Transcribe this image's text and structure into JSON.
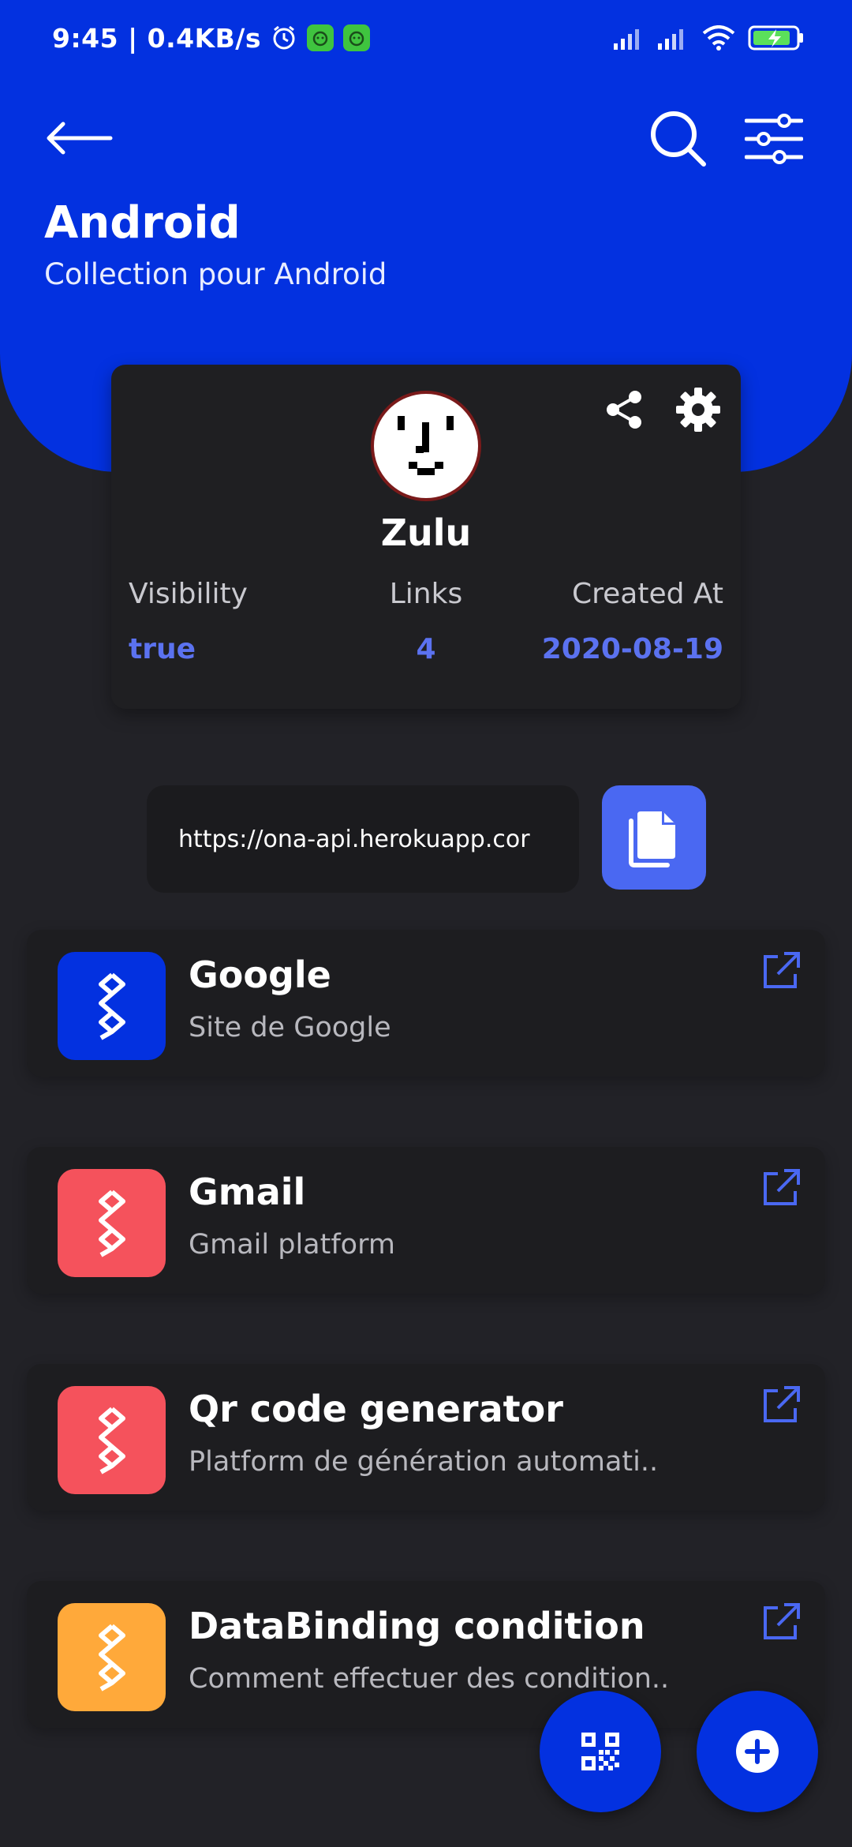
{
  "status_bar": {
    "time_speed": "9:45 | 0.4KB/s"
  },
  "header": {
    "title": "Android",
    "subtitle": "Collection pour Android"
  },
  "profile": {
    "name": "Zulu",
    "stats": [
      {
        "label": "Visibility",
        "value": "true"
      },
      {
        "label": "Links",
        "value": "4"
      },
      {
        "label": "Created At",
        "value": "2020-08-19"
      }
    ]
  },
  "url": {
    "value": "https://ona-api.herokuapp.cor"
  },
  "links": [
    {
      "title": "Google",
      "description": "Site de Google",
      "color": "#0331e0"
    },
    {
      "title": "Gmail",
      "description": "Gmail platform",
      "color": "#f5525c"
    },
    {
      "title": "Qr code generator",
      "description": "Platform de génération automati..",
      "color": "#f5525c"
    },
    {
      "title": "DataBinding condition",
      "description": "Comment effectuer des condition..",
      "color": "#ffa93a"
    }
  ],
  "colors": {
    "primary": "#0331e0",
    "accent": "#5b72f0",
    "background": "#222227"
  },
  "icons": [
    "back-arrow-icon",
    "search-icon",
    "filter-icon",
    "share-icon",
    "gear-icon",
    "copy-icon",
    "link-chain-icon",
    "open-external-icon",
    "qr-code-icon",
    "plus-icon"
  ]
}
